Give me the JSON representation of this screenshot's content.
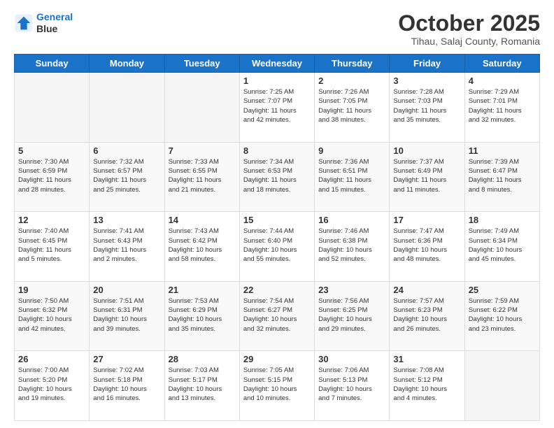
{
  "header": {
    "logo_line1": "General",
    "logo_line2": "Blue",
    "month_title": "October 2025",
    "subtitle": "Tihau, Salaj County, Romania"
  },
  "days_of_week": [
    "Sunday",
    "Monday",
    "Tuesday",
    "Wednesday",
    "Thursday",
    "Friday",
    "Saturday"
  ],
  "weeks": [
    [
      {
        "day": "",
        "info": ""
      },
      {
        "day": "",
        "info": ""
      },
      {
        "day": "",
        "info": ""
      },
      {
        "day": "1",
        "info": "Sunrise: 7:25 AM\nSunset: 7:07 PM\nDaylight: 11 hours\nand 42 minutes."
      },
      {
        "day": "2",
        "info": "Sunrise: 7:26 AM\nSunset: 7:05 PM\nDaylight: 11 hours\nand 38 minutes."
      },
      {
        "day": "3",
        "info": "Sunrise: 7:28 AM\nSunset: 7:03 PM\nDaylight: 11 hours\nand 35 minutes."
      },
      {
        "day": "4",
        "info": "Sunrise: 7:29 AM\nSunset: 7:01 PM\nDaylight: 11 hours\nand 32 minutes."
      }
    ],
    [
      {
        "day": "5",
        "info": "Sunrise: 7:30 AM\nSunset: 6:59 PM\nDaylight: 11 hours\nand 28 minutes."
      },
      {
        "day": "6",
        "info": "Sunrise: 7:32 AM\nSunset: 6:57 PM\nDaylight: 11 hours\nand 25 minutes."
      },
      {
        "day": "7",
        "info": "Sunrise: 7:33 AM\nSunset: 6:55 PM\nDaylight: 11 hours\nand 21 minutes."
      },
      {
        "day": "8",
        "info": "Sunrise: 7:34 AM\nSunset: 6:53 PM\nDaylight: 11 hours\nand 18 minutes."
      },
      {
        "day": "9",
        "info": "Sunrise: 7:36 AM\nSunset: 6:51 PM\nDaylight: 11 hours\nand 15 minutes."
      },
      {
        "day": "10",
        "info": "Sunrise: 7:37 AM\nSunset: 6:49 PM\nDaylight: 11 hours\nand 11 minutes."
      },
      {
        "day": "11",
        "info": "Sunrise: 7:39 AM\nSunset: 6:47 PM\nDaylight: 11 hours\nand 8 minutes."
      }
    ],
    [
      {
        "day": "12",
        "info": "Sunrise: 7:40 AM\nSunset: 6:45 PM\nDaylight: 11 hours\nand 5 minutes."
      },
      {
        "day": "13",
        "info": "Sunrise: 7:41 AM\nSunset: 6:43 PM\nDaylight: 11 hours\nand 2 minutes."
      },
      {
        "day": "14",
        "info": "Sunrise: 7:43 AM\nSunset: 6:42 PM\nDaylight: 10 hours\nand 58 minutes."
      },
      {
        "day": "15",
        "info": "Sunrise: 7:44 AM\nSunset: 6:40 PM\nDaylight: 10 hours\nand 55 minutes."
      },
      {
        "day": "16",
        "info": "Sunrise: 7:46 AM\nSunset: 6:38 PM\nDaylight: 10 hours\nand 52 minutes."
      },
      {
        "day": "17",
        "info": "Sunrise: 7:47 AM\nSunset: 6:36 PM\nDaylight: 10 hours\nand 48 minutes."
      },
      {
        "day": "18",
        "info": "Sunrise: 7:49 AM\nSunset: 6:34 PM\nDaylight: 10 hours\nand 45 minutes."
      }
    ],
    [
      {
        "day": "19",
        "info": "Sunrise: 7:50 AM\nSunset: 6:32 PM\nDaylight: 10 hours\nand 42 minutes."
      },
      {
        "day": "20",
        "info": "Sunrise: 7:51 AM\nSunset: 6:31 PM\nDaylight: 10 hours\nand 39 minutes."
      },
      {
        "day": "21",
        "info": "Sunrise: 7:53 AM\nSunset: 6:29 PM\nDaylight: 10 hours\nand 35 minutes."
      },
      {
        "day": "22",
        "info": "Sunrise: 7:54 AM\nSunset: 6:27 PM\nDaylight: 10 hours\nand 32 minutes."
      },
      {
        "day": "23",
        "info": "Sunrise: 7:56 AM\nSunset: 6:25 PM\nDaylight: 10 hours\nand 29 minutes."
      },
      {
        "day": "24",
        "info": "Sunrise: 7:57 AM\nSunset: 6:23 PM\nDaylight: 10 hours\nand 26 minutes."
      },
      {
        "day": "25",
        "info": "Sunrise: 7:59 AM\nSunset: 6:22 PM\nDaylight: 10 hours\nand 23 minutes."
      }
    ],
    [
      {
        "day": "26",
        "info": "Sunrise: 7:00 AM\nSunset: 5:20 PM\nDaylight: 10 hours\nand 19 minutes."
      },
      {
        "day": "27",
        "info": "Sunrise: 7:02 AM\nSunset: 5:18 PM\nDaylight: 10 hours\nand 16 minutes."
      },
      {
        "day": "28",
        "info": "Sunrise: 7:03 AM\nSunset: 5:17 PM\nDaylight: 10 hours\nand 13 minutes."
      },
      {
        "day": "29",
        "info": "Sunrise: 7:05 AM\nSunset: 5:15 PM\nDaylight: 10 hours\nand 10 minutes."
      },
      {
        "day": "30",
        "info": "Sunrise: 7:06 AM\nSunset: 5:13 PM\nDaylight: 10 hours\nand 7 minutes."
      },
      {
        "day": "31",
        "info": "Sunrise: 7:08 AM\nSunset: 5:12 PM\nDaylight: 10 hours\nand 4 minutes."
      },
      {
        "day": "",
        "info": ""
      }
    ]
  ]
}
